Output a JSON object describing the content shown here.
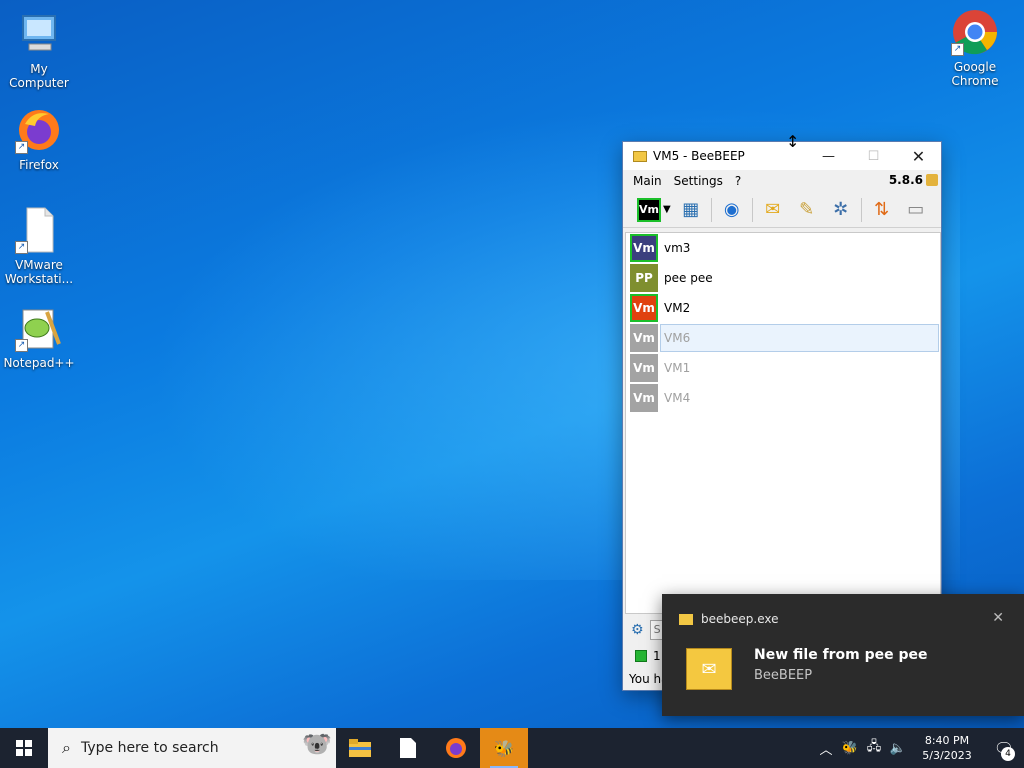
{
  "desktop": {
    "icons": [
      {
        "label": "My Computer",
        "icon": "computer-icon"
      },
      {
        "label": "Firefox",
        "icon": "firefox-icon"
      },
      {
        "label": "VMware Workstati...",
        "icon": "file-icon"
      },
      {
        "label": "Notepad++",
        "icon": "notepad-icon"
      },
      {
        "label": "Google Chrome",
        "icon": "chrome-icon"
      }
    ]
  },
  "window": {
    "title": "VM5 - BeeBEEP",
    "menu": {
      "main": "Main",
      "settings": "Settings",
      "help": "?"
    },
    "version": "5.8.6",
    "status_badge": "Vm",
    "users": [
      {
        "initials": "Vm",
        "name": "vm3",
        "color": "#3b3f7e",
        "status": "online"
      },
      {
        "initials": "PP",
        "name": "pee pee",
        "color": "#7f8f2f",
        "status": "online"
      },
      {
        "initials": "Vm",
        "name": "VM2",
        "color": "#e0420f",
        "status": "online"
      },
      {
        "initials": "Vm",
        "name": "VM6",
        "color": "#a3a3a3",
        "status": "offline"
      },
      {
        "initials": "Vm",
        "name": "VM1",
        "color": "#a3a3a3",
        "status": "offline"
      },
      {
        "initials": "Vm",
        "name": "VM4",
        "color": "#a3a3a3",
        "status": "offline"
      }
    ],
    "search_placeholder": "S",
    "online_count": "1",
    "status_message": "You ha"
  },
  "toast": {
    "app": "beebeep.exe",
    "title": "New file from pee pee",
    "subtitle": "BeeBEEP"
  },
  "taskbar": {
    "search_placeholder": "Type here to search",
    "time": "8:40 PM",
    "date": "5/3/2023",
    "notification_count": "4"
  }
}
